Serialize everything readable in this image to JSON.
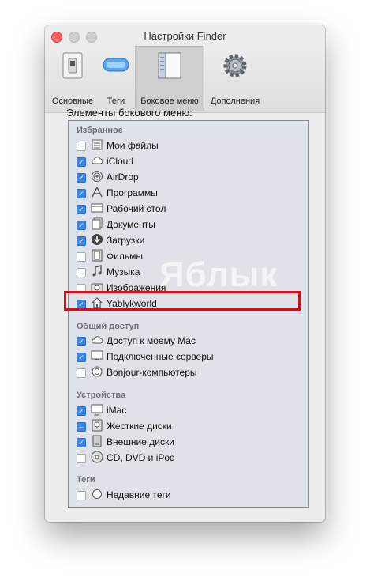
{
  "window": {
    "title": "Настройки Finder"
  },
  "toolbar": {
    "tabs": [
      {
        "label": "Основные",
        "icon": "switch-icon"
      },
      {
        "label": "Теги",
        "icon": "tag-icon"
      },
      {
        "label": "Боковое меню",
        "icon": "sidebar-icon",
        "selected": true
      },
      {
        "label": "Дополнения",
        "icon": "gear-icon"
      }
    ]
  },
  "panel": {
    "title": "Элементы бокового меню:"
  },
  "watermark": "Яблык",
  "groups": {
    "favorites": {
      "title": "Избранное",
      "items": [
        {
          "label": "Мои файлы",
          "checked": false,
          "icon": "all-files-icon"
        },
        {
          "label": "iCloud",
          "checked": true,
          "icon": "cloud-icon"
        },
        {
          "label": "AirDrop",
          "checked": true,
          "icon": "airdrop-icon"
        },
        {
          "label": "Программы",
          "checked": true,
          "icon": "applications-icon"
        },
        {
          "label": "Рабочий стол",
          "checked": true,
          "icon": "desktop-icon"
        },
        {
          "label": "Документы",
          "checked": true,
          "icon": "documents-icon"
        },
        {
          "label": "Загрузки",
          "checked": true,
          "icon": "downloads-icon"
        },
        {
          "label": "Фильмы",
          "checked": false,
          "icon": "movies-icon"
        },
        {
          "label": "Музыка",
          "checked": false,
          "icon": "music-icon"
        },
        {
          "label": "Изображения",
          "checked": false,
          "icon": "camera-icon"
        },
        {
          "label": "Yablykworld",
          "checked": true,
          "icon": "home-icon"
        }
      ]
    },
    "shared": {
      "title": "Общий доступ",
      "items": [
        {
          "label": "Доступ к моему Mac",
          "checked": true,
          "icon": "cloud-icon"
        },
        {
          "label": "Подключенные серверы",
          "checked": true,
          "icon": "display-icon"
        },
        {
          "label": "Bonjour-компьютеры",
          "checked": false,
          "icon": "bonjour-icon"
        }
      ]
    },
    "devices": {
      "title": "Устройства",
      "items": [
        {
          "label": "iMac",
          "checked": true,
          "icon": "imac-icon"
        },
        {
          "label": "Жесткие диски",
          "checked": "mixed",
          "icon": "hard-disk-icon"
        },
        {
          "label": "Внешние диски",
          "checked": true,
          "icon": "external-disk-icon"
        },
        {
          "label": "CD, DVD и iPod",
          "checked": false,
          "icon": "optical-disc-icon"
        }
      ]
    },
    "tags": {
      "title": "Теги",
      "items": [
        {
          "label": "Недавние теги",
          "checked": false,
          "icon": "tag-circle-icon"
        }
      ]
    }
  },
  "colors": {
    "accent": "#3a86e8",
    "highlight": "#d0111b",
    "close": "#fc605c"
  }
}
